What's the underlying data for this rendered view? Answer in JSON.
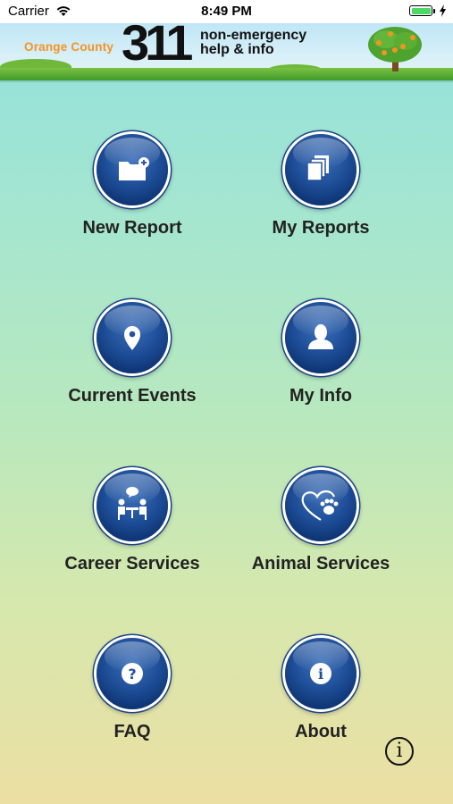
{
  "status_bar": {
    "carrier": "Carrier",
    "time": "8:49 PM",
    "battery_color": "#4cd964"
  },
  "banner": {
    "county": "Orange County",
    "number": "311",
    "tagline_line1": "non-emergency",
    "tagline_line2": "help & info"
  },
  "menu": [
    {
      "label": "New Report",
      "icon": "folder-plus-icon"
    },
    {
      "label": "My Reports",
      "icon": "documents-stack-icon"
    },
    {
      "label": "Current Events",
      "icon": "map-pin-icon"
    },
    {
      "label": "My Info",
      "icon": "person-icon"
    },
    {
      "label": "Career Services",
      "icon": "interview-people-icon"
    },
    {
      "label": "Animal Services",
      "icon": "heart-paw-icon"
    },
    {
      "label": "FAQ",
      "icon": "question-icon"
    },
    {
      "label": "About",
      "icon": "info-icon"
    }
  ],
  "info_button": {
    "glyph": "i",
    "icon": "info-circle-icon"
  },
  "colors": {
    "button_blue": "#1f4f99",
    "county_orange": "#f39423",
    "grass_green": "#3e9a2a"
  }
}
